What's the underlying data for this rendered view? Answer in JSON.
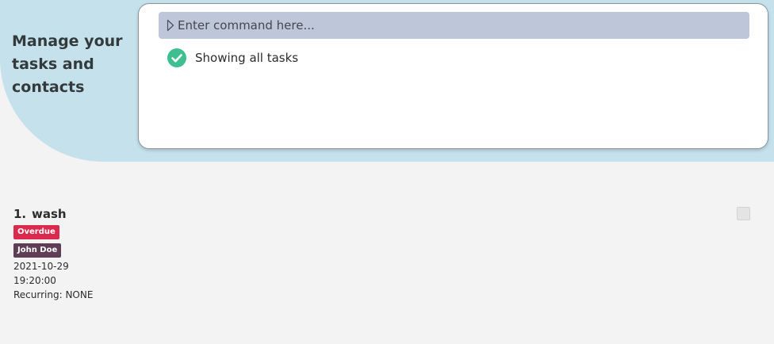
{
  "header": {
    "tagline_lines": [
      "Manage your",
      "tasks and",
      "contacts"
    ]
  },
  "command": {
    "placeholder": "Enter command here...",
    "value": ""
  },
  "result": {
    "message": "Showing all tasks",
    "status": "success",
    "status_color": "#3fbf8f"
  },
  "tasks": [
    {
      "index": "1.",
      "title": "wash",
      "tags": [
        {
          "label": "Overdue",
          "color": "#da2b4f"
        },
        {
          "label": "John Doe",
          "color": "#5e3d55"
        }
      ],
      "date": "2021-10-29",
      "time": "19:20:00",
      "recurring": "Recurring: NONE",
      "done": false
    }
  ],
  "icons": {
    "prompt": "prompt-triangle-icon",
    "status": "check-circle-icon"
  }
}
